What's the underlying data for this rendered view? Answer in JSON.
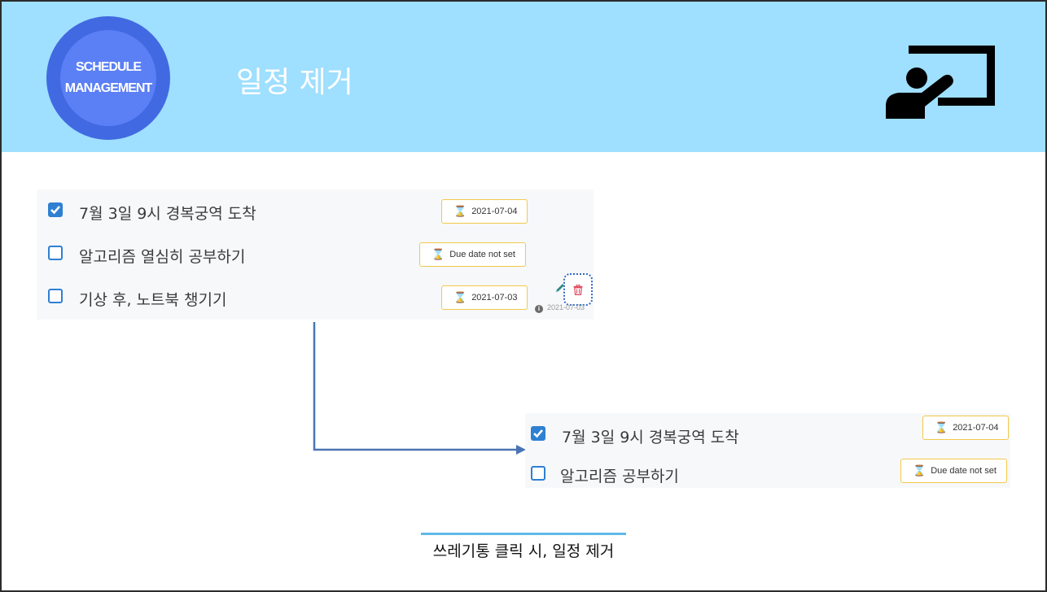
{
  "header": {
    "logo_line1": "SCHEDULE",
    "logo_line2": "MANAGEMENT",
    "title": "일정 제거",
    "icon": "presenter-board-icon"
  },
  "before_list": [
    {
      "label": "7월 3일 9시 경복궁역 도착",
      "checked": true,
      "due": "2021-07-04"
    },
    {
      "label": "알고리즘 열심히 공부하기",
      "checked": false,
      "due": "Due date not set"
    },
    {
      "label": "기상 후, 노트북 챙기기",
      "checked": false,
      "due": "2021-07-03"
    }
  ],
  "row_actions": {
    "edit_icon": "pencil-icon",
    "delete_icon": "trash-icon",
    "created_date": "2021-07-03"
  },
  "after_list": [
    {
      "label": "7월 3일 9시 경복궁역 도착",
      "checked": true,
      "due": "2021-07-04"
    },
    {
      "label": "알고리즘 공부하기",
      "checked": false,
      "due": "Due date not set"
    }
  ],
  "caption": "쓰레기통 클릭 시, 일정 제거",
  "colors": {
    "header_bg": "#9fdfff",
    "logo": "#4169e1",
    "checkbox": "#2f80d1",
    "badge_border": "#f1c84b",
    "arrow": "#4a74b5",
    "delete": "#e0455a"
  }
}
